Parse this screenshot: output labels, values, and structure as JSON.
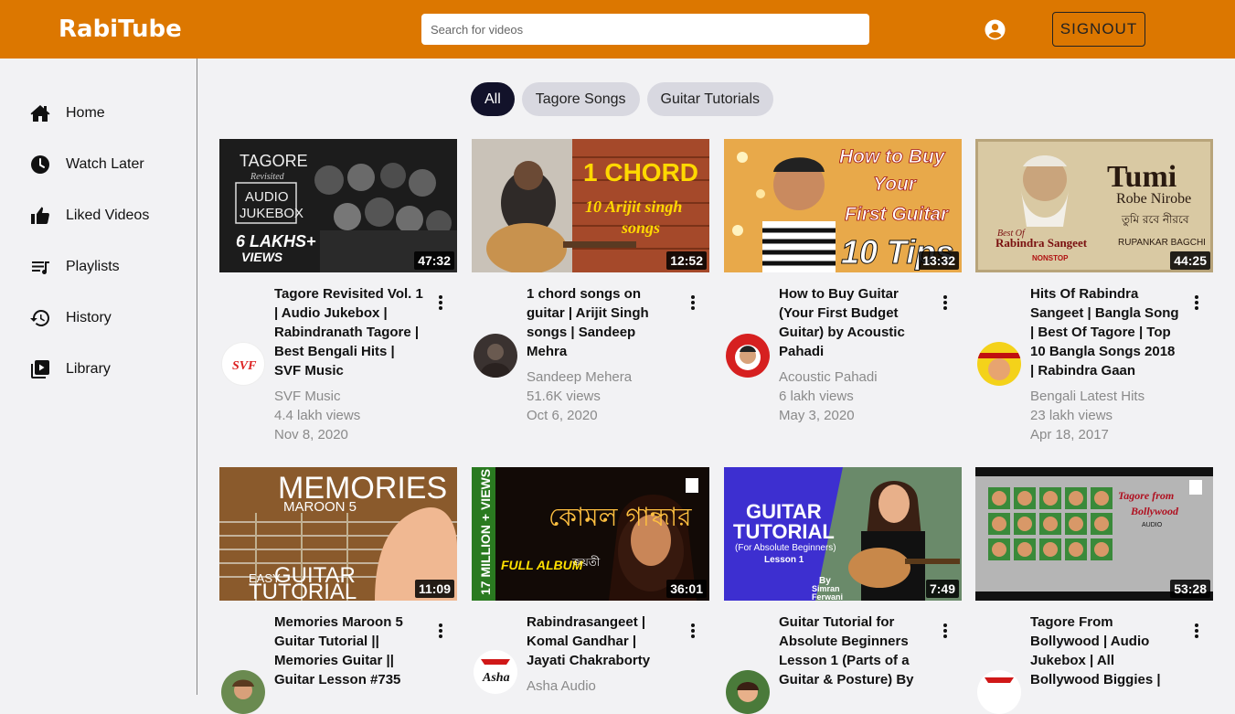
{
  "header": {
    "brand": "RabiTube",
    "search_placeholder": "Search for videos",
    "account_icon": "account-circle-icon",
    "signout_label": "SIGNOUT"
  },
  "sidebar": {
    "items": [
      {
        "label": "Home",
        "icon": "home-icon"
      },
      {
        "label": "Watch Later",
        "icon": "clock-icon"
      },
      {
        "label": "Liked Videos",
        "icon": "thumbs-up-icon"
      },
      {
        "label": "Playlists",
        "icon": "playlist-icon"
      },
      {
        "label": "History",
        "icon": "history-icon"
      },
      {
        "label": "Library",
        "icon": "video-library-icon"
      }
    ]
  },
  "filters": {
    "chips": [
      "All",
      "Tagore Songs",
      "Guitar Tutorials"
    ],
    "selected": "All"
  },
  "thumbnail_texts": {
    "v1": [
      "TAGORE",
      "Revisited",
      "AUDIO",
      "JUKEBOX",
      "6 LAKHS+",
      "VIEWS"
    ],
    "v2": [
      "1 CHORD",
      "10 Arijit singh",
      "songs"
    ],
    "v3": [
      "How to Buy",
      "Your",
      "First Guitar",
      "10 Tips"
    ],
    "v4": [
      "Tumi",
      "Robe Nirobe",
      "তুমি রবে নীরবে",
      "Best Of",
      "Rabindra Sangeet",
      "RUPANKAR BAGCHI",
      "NONSTOP"
    ],
    "v5": [
      "MEMORIES",
      "MAROON 5",
      "EASY",
      "GUITAR",
      "TUTORIAL"
    ],
    "v6": [
      "17 MILLION + VIEWS",
      "FULL ALBUM",
      "কোমল গান্ধার",
      "জয়তী"
    ],
    "v7": [
      "GUITAR",
      "TUTORIAL",
      "(For Absolute Beginners)",
      "Lesson 1",
      "By",
      "Simran",
      "Ferwani"
    ],
    "v8": [
      "Tagore from",
      "Bollywood",
      "AUDIO"
    ]
  },
  "videos": [
    {
      "title": "Tagore Revisited Vol. 1 | Audio Jukebox | Rabindranath Tagore | Best Bengali Hits | SVF Music",
      "channel": "SVF Music",
      "views": "4.4 lakh views",
      "date": "Nov 8, 2020",
      "duration": "47:32",
      "avatar_text": "SVF"
    },
    {
      "title": "1 chord songs on guitar | Arijit Singh songs | Sandeep Mehra",
      "channel": "Sandeep Mehera",
      "views": "51.6K views",
      "date": "Oct 6, 2020",
      "duration": "12:52"
    },
    {
      "title": "How to Buy Guitar (Your First Budget Guitar) by Acoustic Pahadi",
      "channel": "Acoustic Pahadi",
      "views": "6 lakh views",
      "date": "May 3, 2020",
      "duration": "13:32"
    },
    {
      "title": "Hits Of Rabindra Sangeet | Bangla Song | Best Of Tagore | Top 10 Bangla Songs 2018 | Rabindra Gaan",
      "channel": "Bengali Latest Hits",
      "views": "23 lakh views",
      "date": "Apr 18, 2017",
      "duration": "44:25"
    },
    {
      "title": "Memories Maroon 5 Guitar Tutorial || Memories Guitar || Guitar Lesson #735",
      "channel": "",
      "views": "",
      "date": "",
      "duration": "11:09"
    },
    {
      "title": "Rabindrasangeet | Komal Gandhar | Jayati Chakraborty",
      "channel": "Asha Audio",
      "views": "",
      "date": "",
      "duration": "36:01",
      "avatar_text": "Asha"
    },
    {
      "title": "Guitar Tutorial for Absolute Beginners Lesson 1 (Parts of a Guitar & Posture) By",
      "channel": "",
      "views": "",
      "date": "",
      "duration": "7:49"
    },
    {
      "title": "Tagore From Bollywood | Audio Jukebox | All Bollywood Biggies |",
      "channel": "",
      "views": "",
      "date": "",
      "duration": "53:28"
    }
  ]
}
